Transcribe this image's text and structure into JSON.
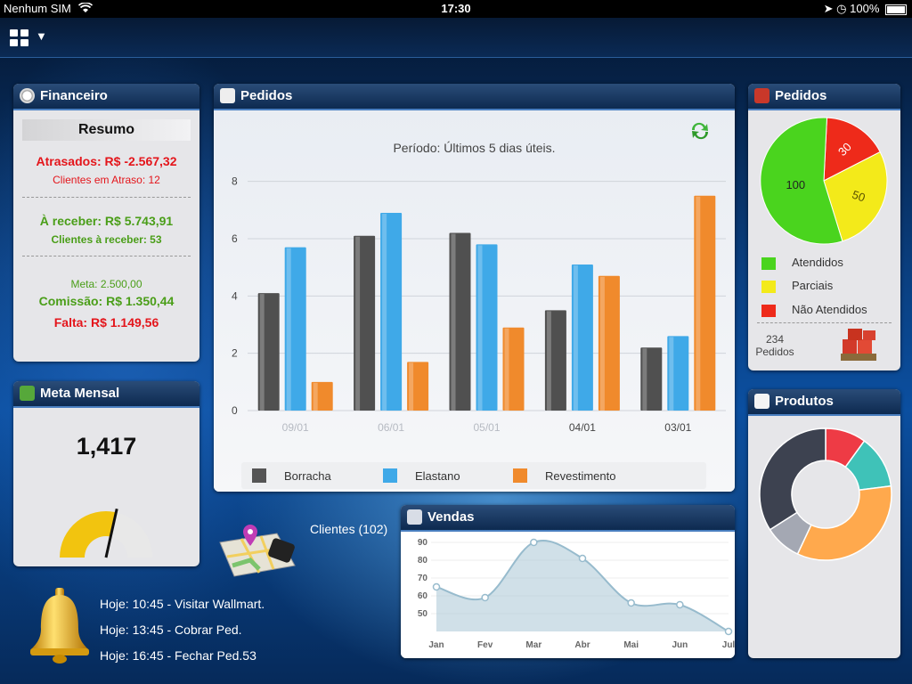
{
  "status": {
    "carrier": "Nenhum SIM",
    "time": "17:30",
    "battery": "100%"
  },
  "icons": [
    "wifi-icon",
    "location-icon",
    "alarm-icon",
    "battery-icon",
    "grid-menu-icon",
    "dropdown-arrow-icon",
    "clock-icon",
    "refresh-icon",
    "boxes-icon",
    "document-icon",
    "cash-icon",
    "map-icon",
    "bell-icon",
    "cube-icon"
  ],
  "financeiro": {
    "title": "Financeiro",
    "resumo": "Resumo",
    "atrasados": "Atrasados: R$ -2.567,32",
    "clientes_atraso": "Clientes em Atraso: 12",
    "a_receber": "À receber: R$ 5.743,91",
    "clientes_receber": "Clientes à receber: 53",
    "meta": "Meta: 2.500,00",
    "comissao": "Comissão: R$ 1.350,44",
    "falta": "Falta: R$ 1.149,56"
  },
  "meta_mensal": {
    "title": "Meta Mensal",
    "value": "1,417",
    "gauge_fraction": 0.57
  },
  "pedidos_chart": {
    "title": "Pedidos",
    "periodo": "Período: Últimos 5 dias úteis.",
    "legend": [
      "Borracha",
      "Elastano",
      "Revestimento"
    ]
  },
  "pedidos_pie": {
    "title": "Pedidos",
    "legend": [
      "Atendidos",
      "Parciais",
      "Não Atendidos"
    ],
    "total_number": "234",
    "total_label": "Pedidos"
  },
  "produtos": {
    "title": "Produtos"
  },
  "vendas": {
    "title": "Vendas"
  },
  "clientes": "Clientes (102)",
  "agenda": [
    "Hoje: 10:45 - Visitar Wallmart.",
    "Hoje: 13:45 - Cobrar Ped.",
    "Hoje: 16:45 - Fechar Ped.53"
  ],
  "colors": {
    "borracha": "#505050",
    "elastano": "#3fa9e8",
    "revestimento": "#f08a2c",
    "atendidos": "#4ad41e",
    "parciais": "#f3ea1a",
    "nao_atendidos": "#ee2a1a"
  },
  "chart_data": [
    {
      "type": "bar",
      "categories": [
        "09/01",
        "06/01",
        "05/01",
        "04/01",
        "03/01"
      ],
      "series": [
        {
          "name": "Borracha",
          "values": [
            4.1,
            6.1,
            6.2,
            3.5,
            2.2
          ]
        },
        {
          "name": "Elastano",
          "values": [
            5.7,
            6.9,
            5.8,
            5.1,
            2.6
          ]
        },
        {
          "name": "Revestimento",
          "values": [
            1.0,
            1.7,
            2.9,
            4.7,
            7.5
          ]
        }
      ],
      "yticks": [
        0,
        2,
        4,
        6,
        8
      ],
      "ylim": [
        0,
        8.3
      ],
      "grid": true,
      "legend": "bottom"
    },
    {
      "type": "pie",
      "labels": [
        "Atendidos",
        "Parciais",
        "Não Atendidos"
      ],
      "values": [
        100,
        50,
        30
      ],
      "data_labels": [
        "100",
        "50",
        "30"
      ]
    },
    {
      "type": "pie",
      "style": "donut",
      "values": [
        10,
        13,
        34,
        9,
        34
      ],
      "slice_colors": [
        "#ee3b45",
        "#3fc2b8",
        "#ffa94d",
        "#a4a8b3",
        "#3d4250"
      ]
    },
    {
      "type": "area",
      "categories": [
        "Jan",
        "Fev",
        "Mar",
        "Abr",
        "Mai",
        "Jun",
        "Jul"
      ],
      "values": [
        65,
        59,
        90,
        81,
        56,
        55,
        40
      ],
      "yticks": [
        50,
        60,
        70,
        80,
        90
      ],
      "ylim": [
        40,
        92
      ]
    }
  ]
}
